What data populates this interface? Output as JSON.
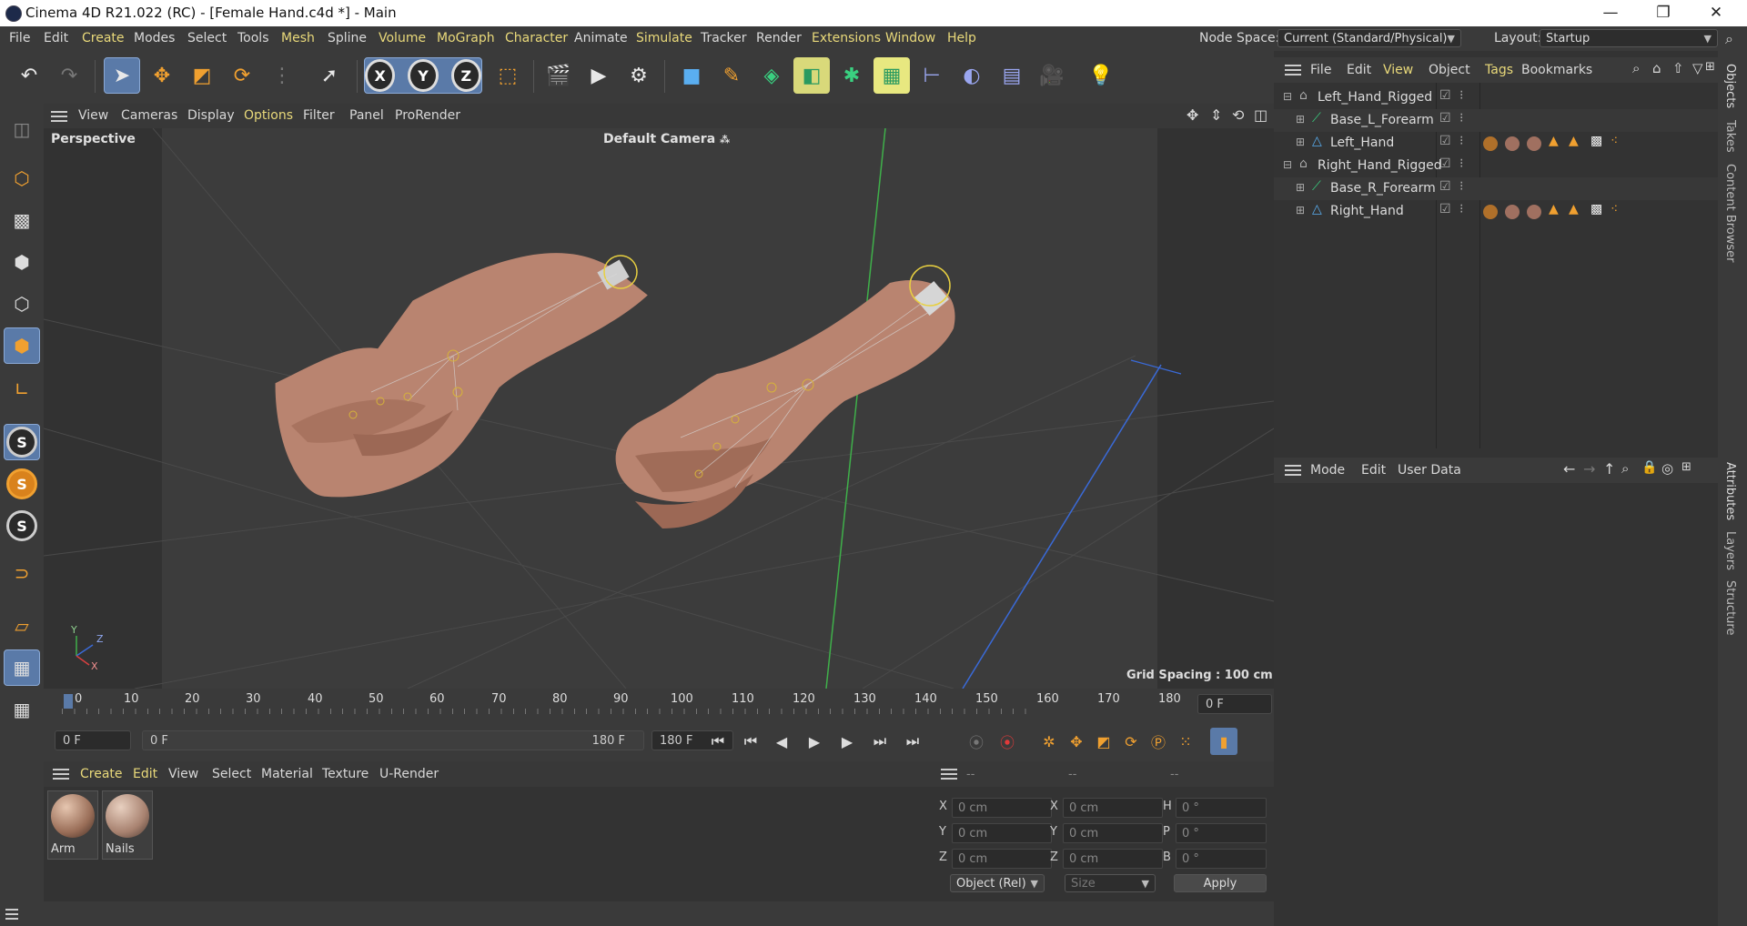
{
  "window": {
    "title": "Cinema 4D R21.022 (RC) - [Female Hand.c4d *] - Main",
    "controls": {
      "minimize": "—",
      "maximize": "❐",
      "close": "✕"
    }
  },
  "menubar": {
    "items": [
      "File",
      "Edit",
      "Create",
      "Modes",
      "Select",
      "Tools",
      "Mesh",
      "Spline",
      "Volume",
      "MoGraph",
      "Character",
      "Animate",
      "Simulate",
      "Tracker",
      "Render",
      "Extensions",
      "Window",
      "Help"
    ],
    "node_space_label": "Node Space:",
    "node_space_value": "Current (Standard/Physical)",
    "layout_label": "Layout:",
    "layout_value": "Startup"
  },
  "toolbar": {
    "undo_icon": "undo-icon",
    "redo_icon": "redo-icon",
    "axis_x": "X",
    "axis_y": "Y",
    "axis_z": "Z"
  },
  "viewport": {
    "menu": [
      "View",
      "Cameras",
      "Display",
      "Options",
      "Filter",
      "Panel",
      "ProRender"
    ],
    "label": "Perspective",
    "camera": "Default Camera",
    "grid_spacing": "Grid Spacing : 100 cm",
    "axis_labels": {
      "x": "X",
      "y": "Y",
      "z": "Z"
    }
  },
  "timeline": {
    "ticks": [
      "0",
      "10",
      "20",
      "30",
      "40",
      "50",
      "60",
      "70",
      "80",
      "90",
      "100",
      "110",
      "120",
      "130",
      "140",
      "150",
      "160",
      "170",
      "180"
    ],
    "current_frame": "0 F",
    "start_frame": "0 F",
    "range_start": "0 F",
    "range_end": "180 F",
    "end_frame": "180 F"
  },
  "material_manager": {
    "menu": [
      "Create",
      "Edit",
      "View",
      "Select",
      "Material",
      "Texture",
      "U-Render"
    ],
    "materials": [
      {
        "name": "Arm"
      },
      {
        "name": "Nails"
      }
    ]
  },
  "coordinates": {
    "headers": [
      "--",
      "--",
      "--"
    ],
    "rows": [
      {
        "a": "X",
        "av": "0 cm",
        "b": "X",
        "bv": "0 cm",
        "c": "H",
        "cv": "0 °"
      },
      {
        "a": "Y",
        "av": "0 cm",
        "b": "Y",
        "bv": "0 cm",
        "c": "P",
        "cv": "0 °"
      },
      {
        "a": "Z",
        "av": "0 cm",
        "b": "Z",
        "bv": "0 cm",
        "c": "B",
        "cv": "0 °"
      }
    ],
    "mode_select": "Object (Rel)",
    "size_select": "Size",
    "apply": "Apply"
  },
  "object_manager": {
    "menu": [
      "File",
      "Edit",
      "View",
      "Object",
      "Tags",
      "Bookmarks"
    ],
    "objects": [
      {
        "name": "Left_Hand_Rigged",
        "indent": 0,
        "icon": "null-icon"
      },
      {
        "name": "Base_L_Forearm",
        "indent": 1,
        "icon": "spline-icon"
      },
      {
        "name": "Left_Hand",
        "indent": 1,
        "icon": "polygon-icon"
      },
      {
        "name": "Right_Hand_Rigged",
        "indent": 0,
        "icon": "null-icon"
      },
      {
        "name": "Base_R_Forearm",
        "indent": 1,
        "icon": "spline-icon"
      },
      {
        "name": "Right_Hand",
        "indent": 1,
        "icon": "polygon-icon"
      }
    ]
  },
  "attribute_manager": {
    "menu": [
      "Mode",
      "Edit",
      "User Data"
    ]
  },
  "side_tabs": {
    "top": [
      "Objects",
      "Takes",
      "Content Browser"
    ],
    "bottom": [
      "Attributes",
      "Layers",
      "Structure"
    ]
  },
  "colors": {
    "accent_highlight": "#e9d97a",
    "selected_tool": "#5a7aa8",
    "bg": "#333333"
  }
}
